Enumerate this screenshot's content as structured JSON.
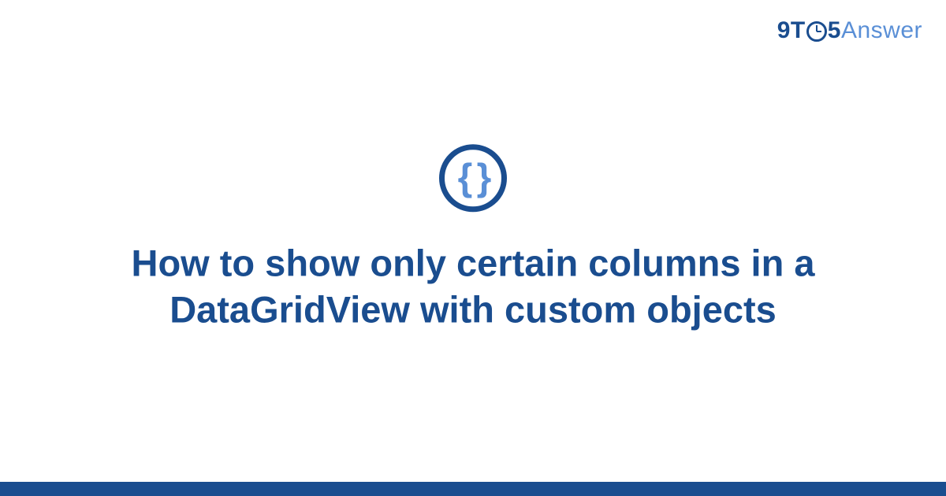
{
  "brand": {
    "prefix": "9T",
    "middle": "5",
    "suffix": "Answer"
  },
  "icon": {
    "name": "code-braces",
    "glyph": "{ }"
  },
  "title": "How to show only certain columns in a DataGridView with custom objects",
  "colors": {
    "primary": "#1a4d8f",
    "accent": "#5a8fd6"
  }
}
